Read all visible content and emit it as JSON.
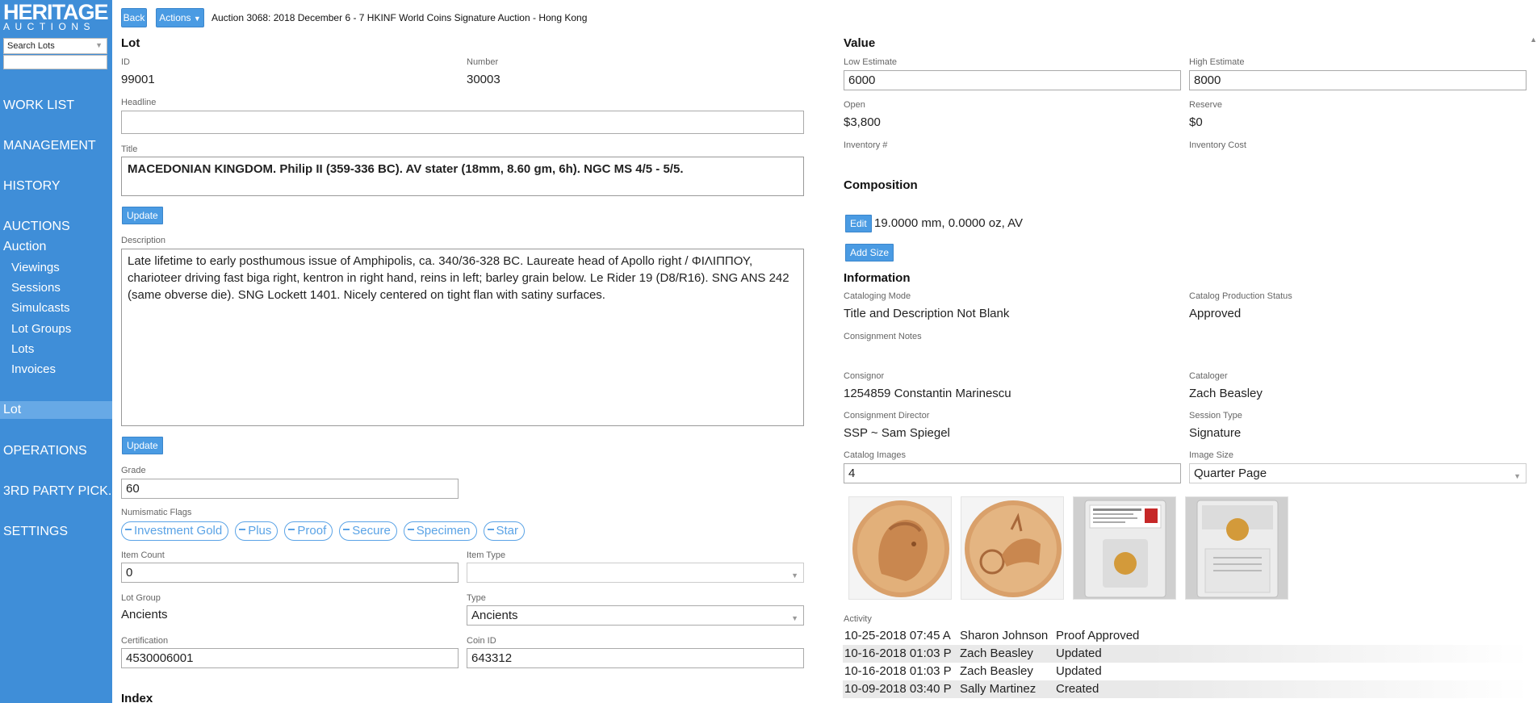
{
  "sidebar": {
    "logo_line1": "HERITAGE",
    "logo_line2": "AUCTIONS",
    "search_select": "Search Lots",
    "nav": [
      {
        "label": "WORK LIST"
      },
      {
        "label": "MANAGEMENT"
      },
      {
        "label": "HISTORY"
      },
      {
        "label": "AUCTIONS"
      },
      {
        "label": "Auction"
      },
      {
        "label": "Viewings"
      },
      {
        "label": "Sessions"
      },
      {
        "label": "Simulcasts"
      },
      {
        "label": "Lot Groups"
      },
      {
        "label": "Lots"
      },
      {
        "label": "Invoices"
      },
      {
        "label": "Lot"
      },
      {
        "label": "OPERATIONS"
      },
      {
        "label": "3RD PARTY PICK..."
      },
      {
        "label": "SETTINGS"
      }
    ]
  },
  "topbar": {
    "back_label": "Back",
    "actions_label": "Actions",
    "breadcrumb": "Auction 3068: 2018 December 6 - 7 HKINF World Coins Signature Auction - Hong Kong"
  },
  "lot": {
    "section_title": "Lot",
    "id_label": "ID",
    "id_value": "99001",
    "number_label": "Number",
    "number_value": "30003",
    "headline_label": "Headline",
    "headline_value": "",
    "title_label": "Title",
    "title_value": "MACEDONIAN KINGDOM. Philip II (359-336 BC). AV stater (18mm, 8.60 gm, 6h). NGC MS 4/5 - 5/5.",
    "update_label": "Update",
    "description_label": "Description",
    "description_value": "Late lifetime to early posthumous issue of Amphipolis, ca. 340/36-328 BC. Laureate head of Apollo right / ΦΙΛΙΠΠΟΥ, charioteer driving fast biga right, kentron in right hand, reins in left; barley grain below. Le Rider 19 (D8/R16). SNG ANS 242 (same obverse die). SNG Lockett 1401. Nicely centered on tight flan with satiny surfaces.",
    "update2_label": "Update",
    "grade_label": "Grade",
    "grade_value": "60",
    "flags_label": "Numismatic Flags",
    "flags": [
      "Investment Gold",
      "Plus",
      "Proof",
      "Secure",
      "Specimen",
      "Star"
    ],
    "item_count_label": "Item Count",
    "item_count_value": "0",
    "item_type_label": "Item Type",
    "item_type_value": "",
    "lot_group_label": "Lot Group",
    "lot_group_value": "Ancients",
    "type_label": "Type",
    "type_value": "Ancients",
    "certification_label": "Certification",
    "certification_value": "4530006001",
    "coin_id_label": "Coin ID",
    "coin_id_value": "643312",
    "index_label": "Index"
  },
  "value": {
    "section_title": "Value",
    "low_label": "Low Estimate",
    "low_value": "6000",
    "high_label": "High Estimate",
    "high_value": "8000",
    "open_label": "Open",
    "open_value": "$3,800",
    "reserve_label": "Reserve",
    "reserve_value": "$0",
    "inventory_label": "Inventory #",
    "inventory_cost_label": "Inventory Cost"
  },
  "composition": {
    "section_title": "Composition",
    "edit_label": "Edit",
    "summary": "19.0000 mm, 0.0000 oz, AV",
    "add_size_label": "Add Size"
  },
  "information": {
    "section_title": "Information",
    "cataloging_mode_label": "Cataloging Mode",
    "cataloging_mode_value": "Title and Description Not Blank",
    "catalog_status_label": "Catalog Production Status",
    "catalog_status_value": "Approved",
    "consignment_notes_label": "Consignment Notes",
    "consignor_label": "Consignor",
    "consignor_value": "1254859 Constantin Marinescu",
    "cataloger_label": "Cataloger",
    "cataloger_value": "Zach Beasley",
    "director_label": "Consignment Director",
    "director_value": "SSP ~ Sam Spiegel",
    "session_type_label": "Session Type",
    "session_type_value": "Signature",
    "catalog_images_label": "Catalog Images",
    "catalog_images_value": "4",
    "image_size_label": "Image Size",
    "image_size_value": "Quarter Page",
    "thumbnails": [
      "coin-obverse-image",
      "coin-reverse-image",
      "slab-front-image",
      "slab-back-image"
    ]
  },
  "activity": {
    "label": "Activity",
    "rows": [
      {
        "time": "10-25-2018 07:45 A",
        "user": "Sharon Johnson",
        "action": "Proof Approved"
      },
      {
        "time": "10-16-2018 01:03 P",
        "user": "Zach Beasley",
        "action": "Updated"
      },
      {
        "time": "10-16-2018 01:03 P",
        "user": "Zach Beasley",
        "action": "Updated"
      },
      {
        "time": "10-09-2018 03:40 P",
        "user": "Sally Martinez",
        "action": "Created"
      }
    ]
  }
}
